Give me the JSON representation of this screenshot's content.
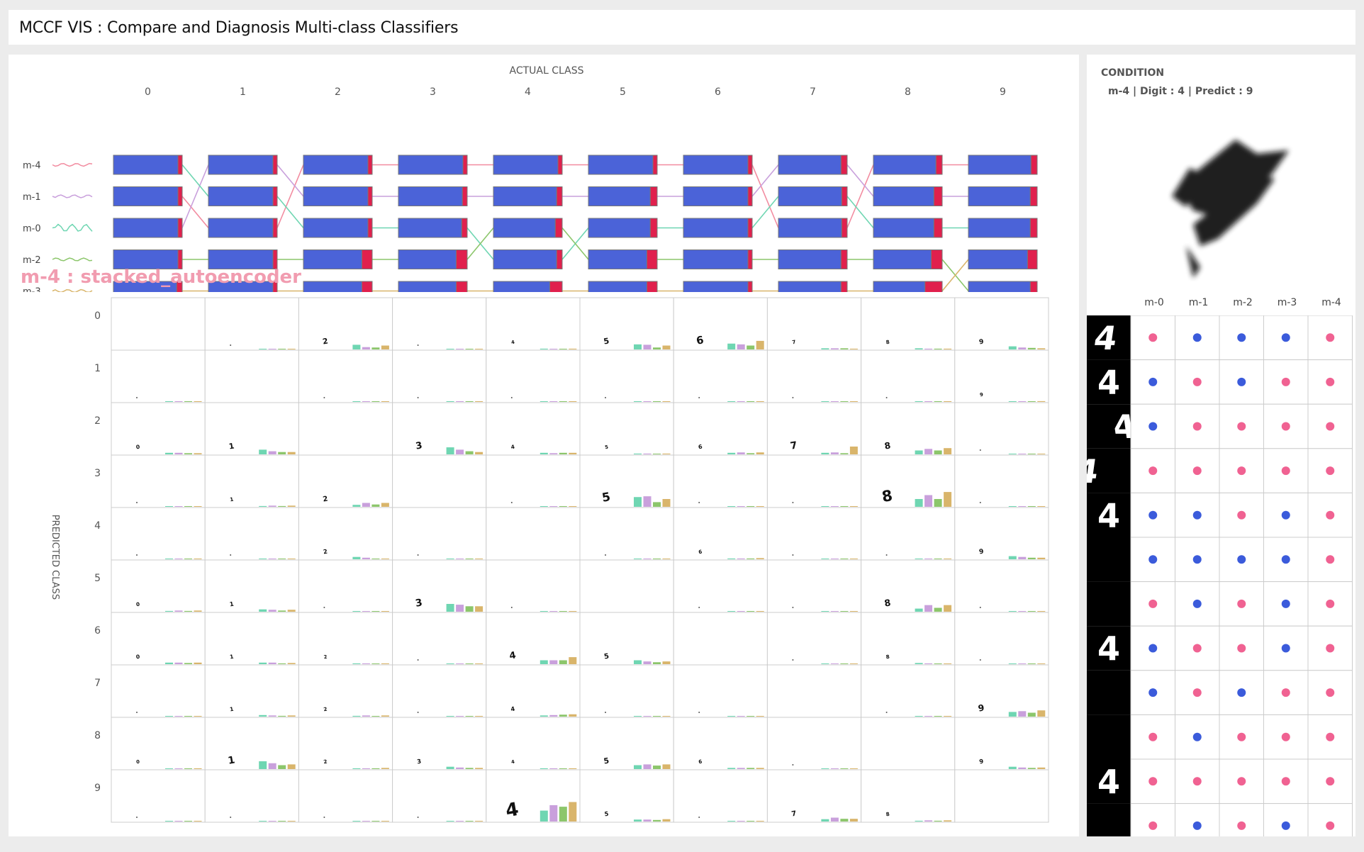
{
  "header": {
    "title": "MCCF VIS : Compare and Diagnosis Multi-class Classifiers"
  },
  "colors": {
    "correct": "#4b63d8",
    "error": "#e0204d",
    "hit_dot": "#f06292",
    "miss_dot": "#3b5bdb",
    "m-4": "#f28ca0",
    "m-1": "#c9a0dc",
    "m-0": "#6fd6b2",
    "m-2": "#8cc66b",
    "m-3": "#d9b56b"
  },
  "overview": {
    "actual_class_label": "ACTUAL CLASS",
    "classes": [
      "0",
      "1",
      "2",
      "3",
      "4",
      "5",
      "6",
      "7",
      "8",
      "9"
    ],
    "models": [
      "m-4",
      "m-1",
      "m-0",
      "m-2",
      "m-3"
    ],
    "error_fraction": [
      [
        0.05,
        0.05,
        0.05,
        0.05,
        0.06,
        0.05,
        0.04,
        0.09,
        0.09,
        0.09
      ],
      [
        0.05,
        0.04,
        0.05,
        0.07,
        0.08,
        0.1,
        0.04,
        0.08,
        0.12,
        0.1
      ],
      [
        0.03,
        0.04,
        0.05,
        0.08,
        0.1,
        0.1,
        0.04,
        0.08,
        0.12,
        0.1
      ],
      [
        0.05,
        0.06,
        0.15,
        0.16,
        0.08,
        0.15,
        0.04,
        0.09,
        0.16,
        0.14
      ],
      [
        0.08,
        0.06,
        0.15,
        0.16,
        0.18,
        0.15,
        0.04,
        0.09,
        0.25,
        0.1
      ]
    ],
    "selected_model_title": "m-4 : stacked_autoencoder"
  },
  "confusion": {
    "predicted_class_label": "PREDICTED CLASS",
    "rows": [
      "0",
      "1",
      "2",
      "3",
      "4",
      "5",
      "6",
      "7",
      "8",
      "9"
    ],
    "cells": [
      [
        null,
        [
          0,
          0,
          0,
          0,
          0
        ],
        [
          0,
          0.12,
          0.06,
          0.05,
          0.1
        ],
        [
          0,
          0,
          0,
          0,
          0
        ],
        [
          0,
          0.02,
          0.01,
          0.01,
          0.02
        ],
        [
          0,
          0.13,
          0.12,
          0.05,
          0.1
        ],
        [
          0,
          0.15,
          0.13,
          0.1,
          0.22
        ],
        [
          0,
          0.03,
          0.03,
          0.03,
          0.02
        ],
        [
          0,
          0.03,
          0.02,
          0.02,
          0.02
        ],
        [
          0,
          0.08,
          0.05,
          0.04,
          0.03
        ]
      ],
      [
        [
          0,
          0,
          0,
          0,
          0
        ],
        null,
        [
          0,
          0,
          0,
          0,
          0
        ],
        [
          0,
          0,
          0,
          0,
          0
        ],
        [
          0,
          0,
          0,
          0,
          0
        ],
        [
          0,
          0,
          0,
          0,
          0
        ],
        [
          0,
          0,
          0,
          0,
          0
        ],
        [
          0,
          0,
          0,
          0,
          0
        ],
        [
          0,
          0,
          0,
          0,
          0
        ],
        [
          0,
          0,
          0,
          0,
          0.02
        ]
      ],
      [
        [
          0,
          0.04,
          0.04,
          0.03,
          0.03
        ],
        [
          0,
          0.12,
          0.08,
          0.06,
          0.06
        ],
        null,
        [
          0,
          0.18,
          0.12,
          0.08,
          0.06
        ],
        [
          0,
          0.04,
          0.03,
          0.04,
          0.04
        ],
        [
          0,
          0.02,
          0.02,
          0.01,
          0.02
        ],
        [
          0,
          0.04,
          0.05,
          0.03,
          0.05
        ],
        [
          0,
          0.04,
          0.05,
          0.03,
          0.2
        ],
        [
          0,
          0.1,
          0.14,
          0.1,
          0.16
        ],
        [
          0,
          0,
          0,
          0,
          0
        ]
      ],
      [
        [
          0,
          0,
          0,
          0,
          0
        ],
        [
          0,
          0.02,
          0.03,
          0.02,
          0.03
        ],
        [
          0,
          0.05,
          0.1,
          0.06,
          0.1
        ],
        null,
        [
          0,
          0,
          0,
          0,
          0
        ],
        [
          0,
          0.25,
          0.27,
          0.12,
          0.2
        ],
        [
          0,
          0,
          0,
          0,
          0
        ],
        [
          0,
          0,
          0,
          0,
          0
        ],
        [
          0,
          0.2,
          0.3,
          0.2,
          0.38
        ],
        [
          0,
          0,
          0,
          0,
          0
        ]
      ],
      [
        [
          0,
          0,
          0,
          0,
          0
        ],
        [
          0,
          0,
          0,
          0,
          0
        ],
        [
          0,
          0.06,
          0.04,
          0,
          0
        ],
        [
          0,
          0,
          0,
          0,
          0
        ],
        null,
        [
          0,
          0,
          0,
          0,
          0
        ],
        [
          0,
          0.02,
          0.02,
          0.02,
          0.03
        ],
        [
          0,
          0,
          0,
          0,
          0
        ],
        [
          0,
          0,
          0,
          0,
          0
        ],
        [
          0,
          0.08,
          0.06,
          0.04,
          0.04
        ]
      ],
      [
        [
          0,
          0.02,
          0.03,
          0.02,
          0.03
        ],
        [
          0,
          0.06,
          0.05,
          0.03,
          0.05
        ],
        [
          0,
          0,
          0,
          0,
          0
        ],
        [
          0,
          0.2,
          0.18,
          0.14,
          0.14
        ],
        [
          0,
          0,
          0,
          0,
          0
        ],
        null,
        [
          0,
          0,
          0,
          0,
          0
        ],
        [
          0,
          0,
          0,
          0,
          0
        ],
        [
          0,
          0.08,
          0.17,
          0.1,
          0.17
        ],
        [
          0,
          0,
          0,
          0,
          0
        ]
      ],
      [
        [
          0,
          0.04,
          0.04,
          0.03,
          0.04
        ],
        [
          0,
          0.04,
          0.04,
          0.02,
          0.03
        ],
        [
          0,
          0.02,
          0.02,
          0,
          0.02
        ],
        [
          0,
          0,
          0,
          0,
          0
        ],
        [
          0,
          0.1,
          0.1,
          0.1,
          0.18
        ],
        [
          0,
          0.1,
          0.07,
          0.05,
          0.07
        ],
        null,
        [
          0,
          0,
          0,
          0,
          0
        ],
        [
          0,
          0.03,
          0.02,
          0,
          0
        ],
        [
          0,
          0,
          0,
          0,
          0
        ]
      ],
      [
        [
          0,
          0,
          0,
          0,
          0
        ],
        [
          0,
          0.04,
          0.03,
          0.02,
          0.03
        ],
        [
          0,
          0.02,
          0.03,
          0,
          0.03
        ],
        [
          0,
          0,
          0,
          0,
          0
        ],
        [
          0,
          0.03,
          0.04,
          0.05,
          0.06
        ],
        [
          0,
          0,
          0,
          0,
          0
        ],
        [
          0,
          0,
          0,
          0,
          0
        ],
        null,
        [
          0,
          0,
          0,
          0,
          0
        ],
        [
          0,
          0.12,
          0.14,
          0.1,
          0.16
        ]
      ],
      [
        [
          0,
          0,
          0,
          0,
          0.02
        ],
        [
          0,
          0.2,
          0.15,
          0.1,
          0.12
        ],
        [
          0,
          0.02,
          0.02,
          0.02,
          0.03
        ],
        [
          0,
          0.06,
          0.04,
          0.03,
          0.03
        ],
        [
          0,
          0.02,
          0.02,
          0.01,
          0.02
        ],
        [
          0,
          0.1,
          0.12,
          0.09,
          0.12
        ],
        [
          0,
          0.03,
          0.03,
          0.03,
          0.03
        ],
        [
          0,
          0,
          0,
          0,
          0
        ],
        null,
        [
          0,
          0.06,
          0.04,
          0.03,
          0.04
        ]
      ],
      [
        [
          0,
          0,
          0,
          0,
          0
        ],
        [
          0,
          0,
          0,
          0,
          0
        ],
        [
          0,
          0,
          0,
          0,
          0
        ],
        [
          0,
          0,
          0,
          0,
          0
        ],
        [
          0,
          0.28,
          0.42,
          0.38,
          0.5
        ],
        [
          0,
          0.05,
          0.05,
          0.04,
          0.06
        ],
        [
          0,
          0,
          0,
          0,
          0
        ],
        [
          0,
          0.06,
          0.1,
          0.07,
          0.07
        ],
        [
          0,
          0.02,
          0.03,
          0.02,
          0.03
        ],
        null
      ]
    ]
  },
  "sidebar": {
    "condition_title": "CONDITION",
    "condition_text": "m-4 | Digit : 4 | Predict : 9",
    "model_columns": [
      "m-0",
      "m-1",
      "m-2",
      "m-3",
      "m-4"
    ],
    "samples": [
      {
        "hits": [
          true,
          false,
          false,
          false,
          true
        ]
      },
      {
        "hits": [
          false,
          true,
          false,
          true,
          true
        ]
      },
      {
        "hits": [
          false,
          true,
          true,
          true,
          true
        ]
      },
      {
        "hits": [
          true,
          true,
          true,
          true,
          true
        ]
      },
      {
        "hits": [
          false,
          false,
          true,
          false,
          true
        ]
      },
      {
        "hits": [
          false,
          false,
          false,
          false,
          true
        ]
      },
      {
        "hits": [
          true,
          false,
          true,
          false,
          true
        ]
      },
      {
        "hits": [
          false,
          true,
          true,
          false,
          true
        ]
      },
      {
        "hits": [
          false,
          true,
          false,
          true,
          true
        ]
      },
      {
        "hits": [
          true,
          false,
          true,
          true,
          true
        ]
      },
      {
        "hits": [
          true,
          true,
          true,
          true,
          true
        ]
      },
      {
        "hits": [
          true,
          false,
          true,
          false,
          true
        ]
      }
    ]
  }
}
